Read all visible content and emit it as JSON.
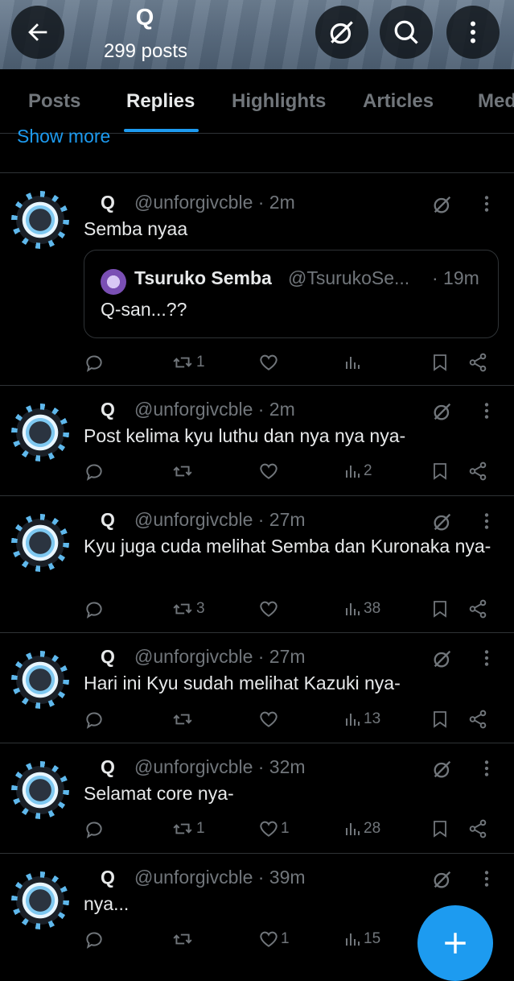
{
  "header": {
    "title": "Q",
    "subtitle": "299 posts"
  },
  "tabs": [
    {
      "label": "Posts",
      "active": false
    },
    {
      "label": "Replies",
      "active": true
    },
    {
      "label": "Highlights",
      "active": false
    },
    {
      "label": "Articles",
      "active": false
    },
    {
      "label": "Med",
      "active": false
    }
  ],
  "show_more": "Show more",
  "posts": [
    {
      "name": "Q",
      "handle": "@unforgivcble · 2m",
      "text": "Semba nyaa",
      "quote": {
        "name": "Tsuruko Semba",
        "handle": "@TsurukoSe...",
        "time": "· 19m",
        "text": "Q-san...??"
      },
      "reply": "",
      "repost": "1",
      "like": "",
      "views": ""
    },
    {
      "name": "Q",
      "handle": "@unforgivcble · 2m",
      "text": "Post kelima kyu luthu dan nya nya nya-",
      "reply": "",
      "repost": "",
      "like": "",
      "views": "2"
    },
    {
      "name": "Q",
      "handle": "@unforgivcble · 27m",
      "text": "Kyu juga cuda melihat Semba dan Kuronaka nya-",
      "reply": "",
      "repost": "3",
      "like": "",
      "views": "38"
    },
    {
      "name": "Q",
      "handle": "@unforgivcble · 27m",
      "text": "Hari ini Kyu sudah melihat Kazuki nya-",
      "reply": "",
      "repost": "",
      "like": "",
      "views": "13"
    },
    {
      "name": "Q",
      "handle": "@unforgivcble · 32m",
      "text": "Selamat core nya-",
      "reply": "",
      "repost": "1",
      "like": "1",
      "views": "28"
    },
    {
      "name": "Q",
      "handle": "@unforgivcble · 39m",
      "text": "nya...",
      "reply": "",
      "repost": "",
      "like": "1",
      "views": "15"
    }
  ],
  "colors": {
    "accent": "#1d9bf0",
    "muted": "#71767b",
    "text": "#e7e9ea",
    "border": "#2f3336"
  },
  "icons": [
    "back-arrow-icon",
    "grok-icon",
    "search-icon",
    "more-vertical-icon",
    "reply-icon",
    "repost-icon",
    "like-icon",
    "views-icon",
    "bookmark-icon",
    "share-icon",
    "compose-plus-icon"
  ]
}
